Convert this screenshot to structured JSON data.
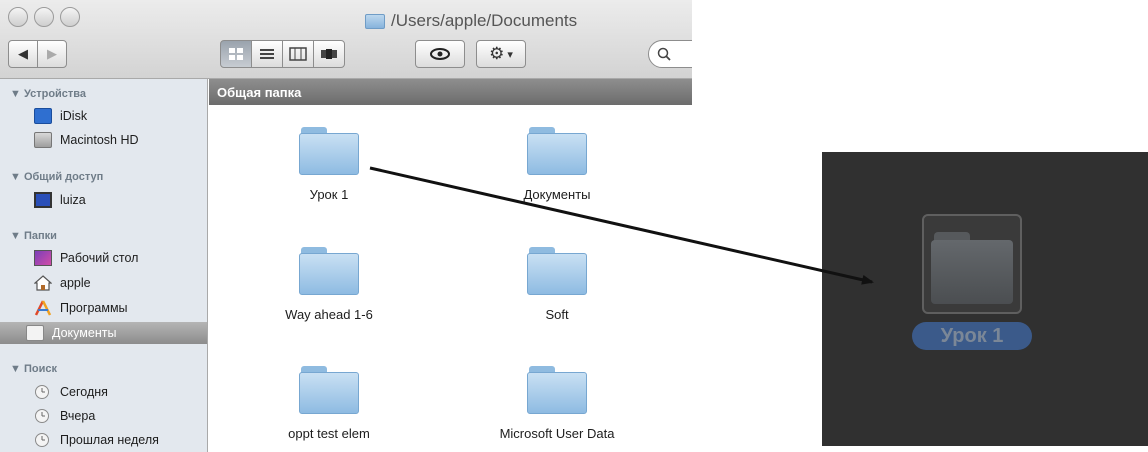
{
  "window": {
    "path_title": "/Users/apple/Documents"
  },
  "toolbar": {
    "back_label": "◀",
    "forward_label": "▶",
    "view_modes": [
      "icon",
      "list",
      "columns",
      "coverflow"
    ],
    "quicklook_icon": "eye-icon",
    "action_icon": "gear-icon",
    "action_arrow": "▾",
    "search_icon_glyph": "🔍"
  },
  "sidebar": {
    "devices_header": "▼ Устройства",
    "devices": [
      {
        "label": "iDisk",
        "icon": "idisk-icon"
      },
      {
        "label": "Macintosh HD",
        "icon": "hard-drive-icon"
      }
    ],
    "shared_header": "▼ Общий доступ",
    "shared": [
      {
        "label": "luiza",
        "icon": "computer-icon"
      }
    ],
    "places_header": "▼ Папки",
    "places": [
      {
        "label": "Рабочий стол",
        "icon": "desktop-icon"
      },
      {
        "label": "apple",
        "icon": "home-icon"
      },
      {
        "label": "Программы",
        "icon": "applications-icon"
      },
      {
        "label": "Документы",
        "icon": "documents-icon",
        "selected": true
      }
    ],
    "search_header": "▼ Поиск",
    "searches": [
      {
        "label": "Сегодня",
        "icon": "clock-icon"
      },
      {
        "label": "Вчера",
        "icon": "clock-icon"
      },
      {
        "label": "Прошлая неделя",
        "icon": "clock-icon"
      }
    ]
  },
  "content": {
    "header": "Общая папка",
    "items": [
      {
        "label": "Урок 1"
      },
      {
        "label": "Документы"
      },
      {
        "label": "Way ahead 1-6"
      },
      {
        "label": "Soft"
      },
      {
        "label": "oppt test elem"
      },
      {
        "label": "Microsoft User Data"
      }
    ]
  },
  "zoom_panel": {
    "label": "Урок 1"
  },
  "colors": {
    "selection": "#3b5a8a",
    "folder": "#8ebbe2",
    "panel": "#303030"
  }
}
